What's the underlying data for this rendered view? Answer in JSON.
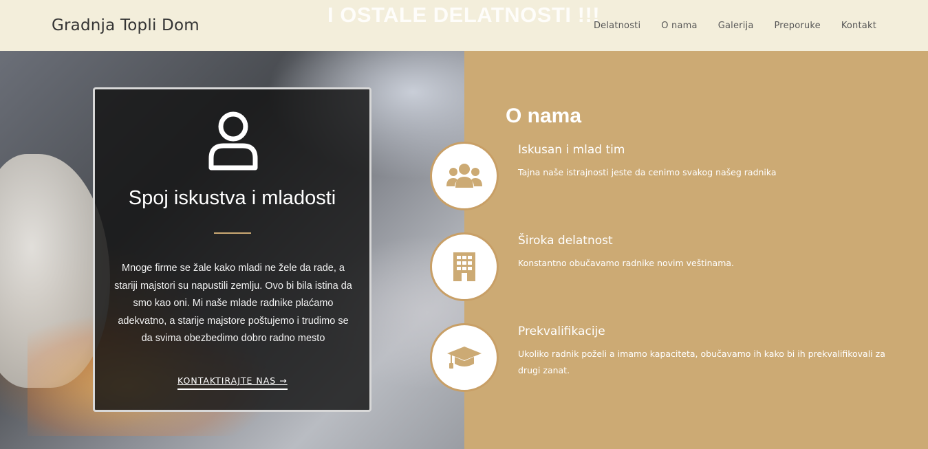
{
  "header": {
    "ghost_text": "I OSTALE DELATNOSTI !!!",
    "brand": "Gradnja Topli Dom",
    "nav": [
      "Delatnosti",
      "O nama",
      "Galerija",
      "Preporuke",
      "Kontakt"
    ]
  },
  "hero": {
    "icon": "user-icon",
    "title": "Spoj iskustva i mladosti",
    "text": "Mnoge firme se žale kako mladi ne žele da rade, a stariji majstori su napustili zemlju. Ovo bi bila istina da smo kao oni. Mi naše mlade radnike plaćamo adekvatno, a starije majstore poštujemo i trudimo se da svima obezbedimo dobro radno mesto",
    "cta": "KONTAKTIRAJTE NAS →"
  },
  "about": {
    "title": "O nama",
    "features": [
      {
        "icon": "team-icon",
        "title": "Iskusan i mlad tim",
        "desc": "Tajna naše istrajnosti jeste da cenimo svakog našeg radnika"
      },
      {
        "icon": "building-icon",
        "title": "Široka delatnost",
        "desc": "Konstantno obučavamo radnike novim veštinama."
      },
      {
        "icon": "graduation-cap-icon",
        "title": "Prekvalifikacije",
        "desc": "Ukoliko radnik poželi a imamo kapaciteta, obučavamo ih kako bi ih prekvalifikovali za drugi zanat."
      }
    ]
  },
  "colors": {
    "header_bg": "#f3eedb",
    "accent": "#ccaa74",
    "card_bg": "#141414"
  }
}
